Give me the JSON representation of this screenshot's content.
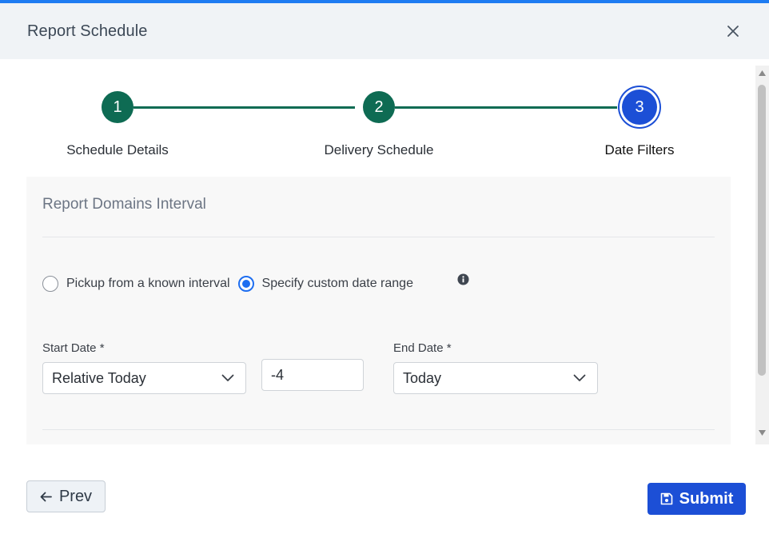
{
  "header": {
    "title": "Report Schedule"
  },
  "stepper": {
    "steps": [
      {
        "number": "1",
        "label": "Schedule Details"
      },
      {
        "number": "2",
        "label": "Delivery Schedule"
      },
      {
        "number": "3",
        "label": "Date Filters"
      }
    ],
    "active_step": 3
  },
  "panel": {
    "title": "Report Domains Interval",
    "radio_options": [
      {
        "label": "Pickup from a known interval",
        "checked": false
      },
      {
        "label": "Specify custom date range",
        "checked": true
      }
    ],
    "start_date": {
      "label": "Start Date *",
      "selected": "Relative Today",
      "offset_value": "-4"
    },
    "end_date": {
      "label": "End Date *",
      "selected": "Today"
    }
  },
  "footer": {
    "prev_label": "Prev",
    "submit_label": "Submit"
  },
  "colors": {
    "accent": "#1c4fd6",
    "step_done": "#0e6b53",
    "radio": "#1e6ef0"
  },
  "icons": [
    "close-icon",
    "info-icon",
    "chevron-down-icon",
    "arrow-left-icon",
    "save-icon"
  ]
}
